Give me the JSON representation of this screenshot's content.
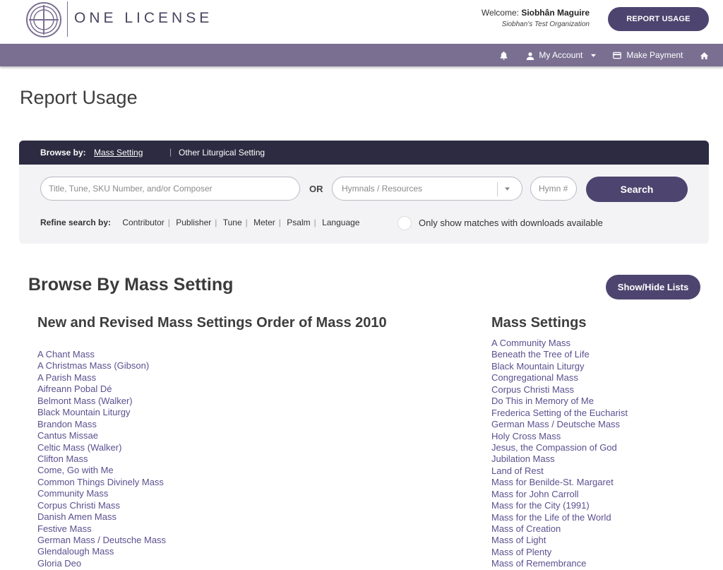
{
  "header": {
    "logo_text": "ONE LICENSE",
    "welcome_prefix": "Welcome:",
    "user_name": "Siobhân Maguire",
    "organization": "Siobhan's Test Organization",
    "report_button": "REPORT USAGE"
  },
  "nav": {
    "bell_icon": "bell-icon",
    "account": "My Account",
    "payment": "Make Payment",
    "home_icon": "home-icon"
  },
  "page_title": "Report Usage",
  "search": {
    "browse_label": "Browse by:",
    "tab_mass": "Mass Setting",
    "tab_other": "Other Liturgical Setting",
    "query_placeholder": "Title, Tune, SKU Number, and/or Composer",
    "or_label": "OR",
    "hymnal_placeholder": "Hymnals / Resources",
    "hymn_placeholder": "Hymn #",
    "search_button": "Search",
    "refine_label": "Refine search by:",
    "refine": [
      "Contributor",
      "Publisher",
      "Tune",
      "Meter",
      "Psalm",
      "Language"
    ],
    "downloads_label": "Only show matches with downloads available"
  },
  "browse": {
    "title": "Browse By Mass Setting",
    "toggle_button": "Show/Hide Lists",
    "left_title": "New and Revised Mass Settings Order of Mass 2010",
    "left_items": [
      "A Chant Mass",
      "A Christmas Mass (Gibson)",
      "A Parish Mass",
      "Aifreann Pobal Dé",
      "Belmont Mass (Walker)",
      "Black Mountain Liturgy",
      "Brandon Mass",
      "Cantus Missae",
      "Celtic Mass (Walker)",
      "Clifton Mass",
      "Come, Go with Me",
      "Common Things Divinely Mass",
      "Community Mass",
      "Corpus Christi Mass",
      "Danish Amen Mass",
      "Festive Mass",
      "German Mass / Deutsche Mass",
      "Glendalough Mass",
      "Gloria Deo"
    ],
    "right_title": "Mass Settings",
    "right_items": [
      "A Community Mass",
      "Beneath the Tree of Life",
      "Black Mountain Liturgy",
      "Congregational Mass",
      "Corpus Christi Mass",
      "Do This in Memory of Me",
      "Frederica Setting of the Eucharist",
      "German Mass / Deutsche Mass",
      "Holy Cross Mass",
      "Jesus, the Compassion of God",
      "Jubilation Mass",
      "Land of Rest",
      "Mass for Benilde-St. Margaret",
      "Mass for John Carroll",
      "Mass for the City (1991)",
      "Mass for the Life of the World",
      "Mass of Creation",
      "Mass of Light",
      "Mass of Plenty",
      "Mass of Remembrance"
    ]
  }
}
